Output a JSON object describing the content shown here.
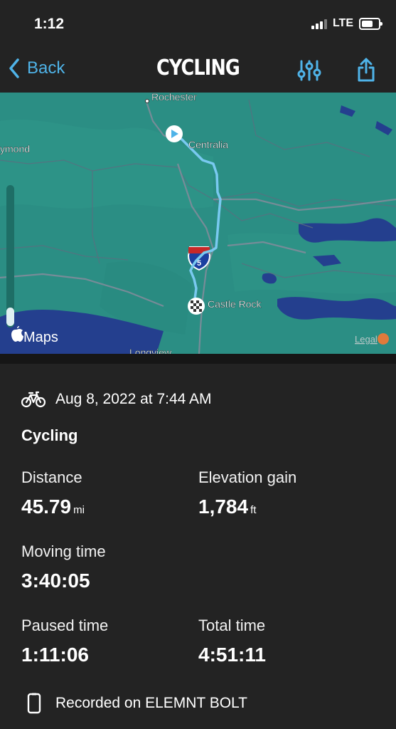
{
  "status_bar": {
    "time": "1:12",
    "network": "LTE"
  },
  "nav": {
    "back_label": "Back",
    "title": "CYCLING",
    "filter_icon": "sliders-icon",
    "share_icon": "share-icon"
  },
  "map": {
    "labels": {
      "rochester": "Rochester",
      "raymond": "ymond",
      "centralia": "Centralia",
      "castle_rock": "Castle Rock",
      "longview": "Longview",
      "interstate": "5"
    },
    "attribution": "Maps",
    "legal": "Legal",
    "colors": {
      "land": "#2b8e84",
      "water": "#243f8e",
      "route": "#79c9f0"
    }
  },
  "activity": {
    "date": "Aug 8, 2022 at 7:44 AM",
    "title": "Cycling",
    "stats": {
      "distance": {
        "label": "Distance",
        "value": "45.79",
        "unit": "mi"
      },
      "elevation": {
        "label": "Elevation gain",
        "value": "1,784",
        "unit": "ft"
      },
      "moving": {
        "label": "Moving time",
        "value": "3:40:05"
      },
      "paused": {
        "label": "Paused time",
        "value": "1:11:06"
      },
      "total": {
        "label": "Total time",
        "value": "4:51:11"
      }
    },
    "recorded_on": "Recorded on ELEMNT BOLT"
  }
}
